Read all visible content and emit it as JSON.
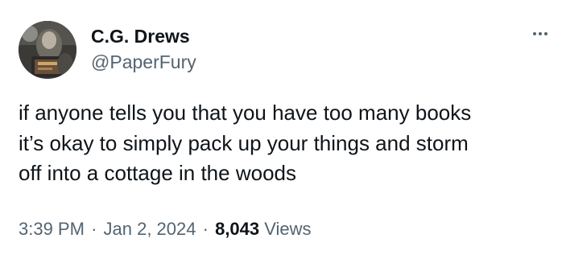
{
  "author": {
    "display_name": "C.G. Drews",
    "handle": "@PaperFury",
    "avatar_icon": "profile-photo"
  },
  "more_icon": "ellipsis-icon",
  "tweet": {
    "text_lines": [
      "if anyone tells you that you have too many books",
      "it’s okay to simply pack up your things and storm",
      "off into a cottage in the woods"
    ]
  },
  "meta": {
    "time": "3:39 PM",
    "separator": "·",
    "date": "Jan 2, 2024",
    "views_count": "8,043",
    "views_label": "Views"
  },
  "colors": {
    "text_primary": "#0f1419",
    "text_secondary": "#536471",
    "background": "#ffffff"
  }
}
